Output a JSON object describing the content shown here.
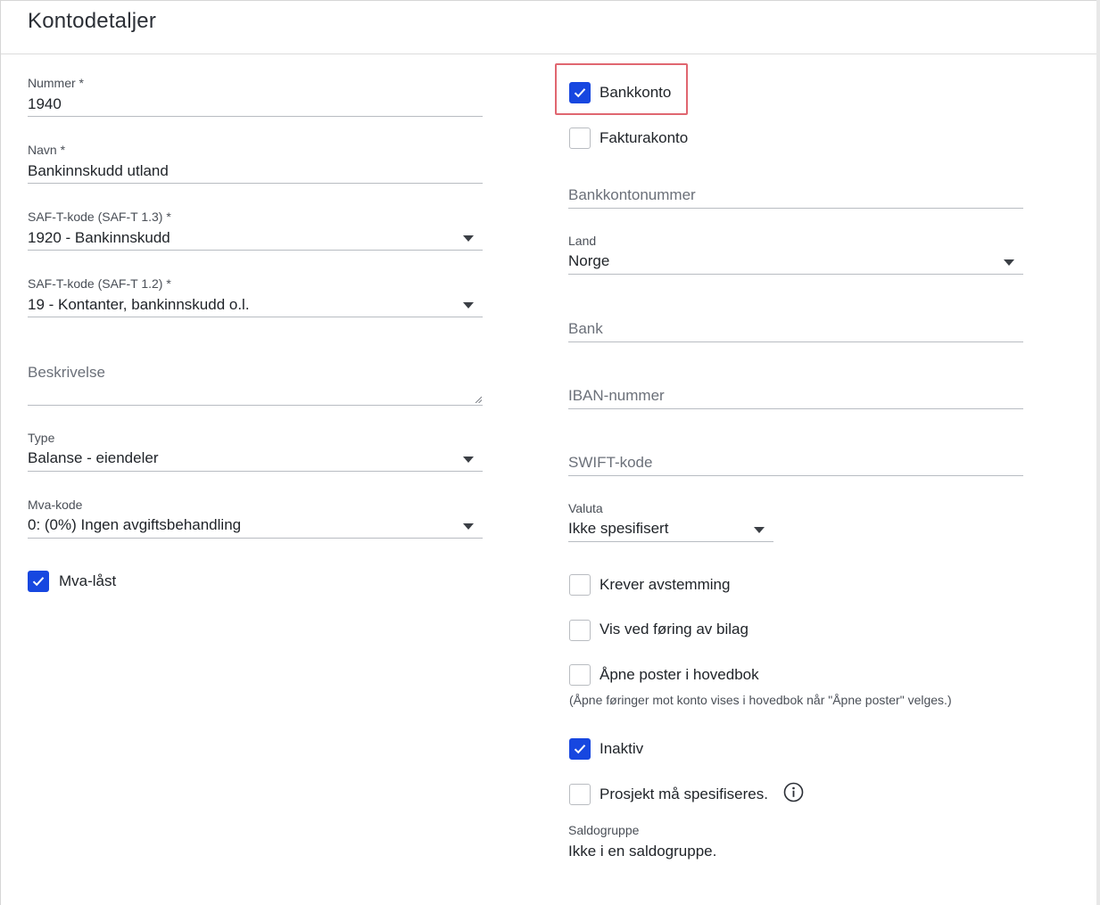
{
  "header": {
    "title": "Kontodetaljer"
  },
  "left": {
    "nummer": {
      "label": "Nummer *",
      "value": "1940"
    },
    "navn": {
      "label": "Navn *",
      "value": "Bankinnskudd utland"
    },
    "saft13": {
      "label": "SAF-T-kode (SAF-T 1.3) *",
      "value": "1920 - Bankinnskudd"
    },
    "saft12": {
      "label": "SAF-T-kode (SAF-T 1.2) *",
      "value": "19 - Kontanter, bankinnskudd o.l."
    },
    "beskrivelse": {
      "placeholder": "Beskrivelse"
    },
    "type": {
      "label": "Type",
      "value": "Balanse - eiendeler"
    },
    "mvakode": {
      "label": "Mva-kode",
      "value": "0: (0%) Ingen avgiftsbehandling"
    },
    "mvalast": {
      "label": "Mva-låst",
      "checked": true
    }
  },
  "right": {
    "bankkonto": {
      "label": "Bankkonto",
      "checked": true
    },
    "fakturakonto": {
      "label": "Fakturakonto",
      "checked": false
    },
    "bankkontonummer": {
      "placeholder": "Bankkontonummer"
    },
    "land": {
      "label": "Land",
      "value": "Norge"
    },
    "bank": {
      "placeholder": "Bank"
    },
    "iban": {
      "placeholder": "IBAN-nummer"
    },
    "swift": {
      "placeholder": "SWIFT-kode"
    },
    "valuta": {
      "label": "Valuta",
      "value": "Ikke spesifisert"
    },
    "krever_avstemming": {
      "label": "Krever avstemming",
      "checked": false
    },
    "vis_ved_foring": {
      "label": "Vis ved føring av bilag",
      "checked": false
    },
    "apne_poster": {
      "label": "Åpne poster i hovedbok",
      "checked": false
    },
    "apne_poster_note": "(Åpne føringer mot konto vises i hovedbok når \"Åpne poster\" velges.)",
    "inaktiv": {
      "label": "Inaktiv",
      "checked": true
    },
    "prosjekt": {
      "label": "Prosjekt må spesifiseres.",
      "checked": false
    },
    "saldogruppe": {
      "label": "Saldogruppe",
      "value": "Ikke i en saldogruppe."
    }
  },
  "icons": {
    "checkmark": "check-icon",
    "dropdown": "chevron-down-icon",
    "info": "info-icon",
    "resize": "resize-handle-icon"
  },
  "colors": {
    "accent": "#1747e0",
    "highlight": "#e06670"
  }
}
